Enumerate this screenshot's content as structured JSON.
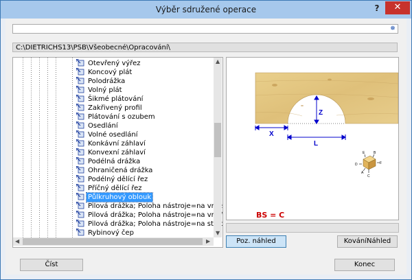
{
  "window": {
    "title": "Výběr sdružené operace",
    "help_label": "?",
    "close_label": "✕"
  },
  "search": {
    "value": "",
    "button_icon": "search-icon"
  },
  "path_text": "C:\\DIETRICHS13\\PSB\\Všeobecné\\Opracování\\",
  "tree": {
    "items": [
      {
        "label": "Otevřený výřez"
      },
      {
        "label": "Koncový plát"
      },
      {
        "label": "Polodrážka"
      },
      {
        "label": "Volný plát"
      },
      {
        "label": "Šikmé plátování"
      },
      {
        "label": "Zakřivený profil"
      },
      {
        "label": "Plátování s ozubem"
      },
      {
        "label": "Osedlání"
      },
      {
        "label": "Volné osedlání"
      },
      {
        "label": "Konkávní záhlaví"
      },
      {
        "label": "Konvexní záhlaví"
      },
      {
        "label": "Podélná drážka"
      },
      {
        "label": "Ohraničená drážka"
      },
      {
        "label": "Podélný dělící řez"
      },
      {
        "label": "Příčný dělící řez"
      },
      {
        "label": "Půlkruhový oblouk",
        "selected": true
      },
      {
        "label": "Pilová drážka; Poloha nástroje=na vnější"
      },
      {
        "label": "Pilová drážka; Poloha nástroje=na vnitřn"
      },
      {
        "label": "Pilová drážka; Poloha nástroje=na střed"
      },
      {
        "label": "Rybinový čep"
      }
    ]
  },
  "preview": {
    "dim_x": "X",
    "dim_z": "Z",
    "dim_l": "L",
    "formula": "BS = C",
    "cube_labels": {
      "a": "A",
      "b": "B",
      "c": "C",
      "d": "D",
      "e": "E",
      "f": "F"
    },
    "accent": "#0000cc",
    "formula_color": "#cc0000"
  },
  "buttons": {
    "preview_position": "Poz. náhled",
    "preview_render": "KováníNáhled",
    "read": "Číst",
    "end": "Konec"
  }
}
